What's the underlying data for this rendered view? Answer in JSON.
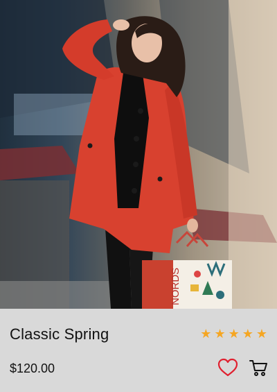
{
  "product": {
    "title": "Classic Spring",
    "price": "$120.00",
    "rating": 5,
    "rating_max": 5,
    "star_glyph": "★"
  },
  "image": {
    "bag_text": "NORDS"
  },
  "colors": {
    "star": "#f5a623",
    "heart": "#e0202f",
    "panel": "#d9d9d9",
    "coat": "#d8412f"
  },
  "icons": {
    "favorite": "heart-icon",
    "cart": "cart-icon"
  }
}
